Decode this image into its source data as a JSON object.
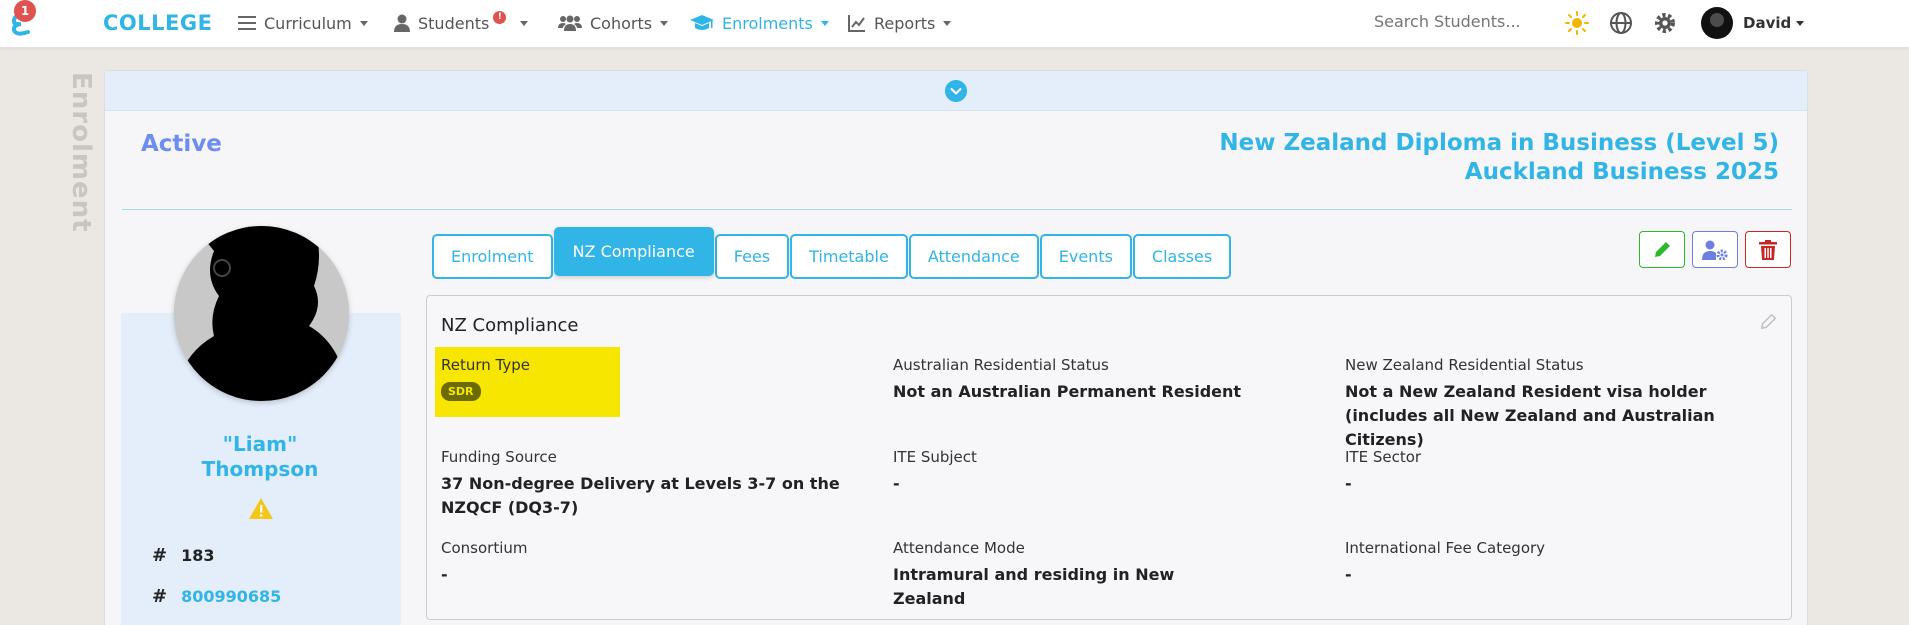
{
  "nav": {
    "notification_count": "1",
    "brand": "COLLEGE",
    "items": [
      {
        "label": "Curriculum",
        "icon": "list-icon"
      },
      {
        "label": "Students",
        "icon": "user-icon",
        "alert": "!"
      },
      {
        "label": "Cohorts",
        "icon": "users-icon"
      },
      {
        "label": "Enrolments",
        "icon": "graduation-cap-icon",
        "active": true
      },
      {
        "label": "Reports",
        "icon": "line-chart-icon"
      }
    ],
    "search_placeholder": "Search Students...",
    "user_name": "David"
  },
  "side_label": "Enrolment",
  "enrolment": {
    "status": "Active",
    "programme": "New Zealand Diploma in Business (Level 5)",
    "cohort": "Auckland Business 2025"
  },
  "student": {
    "nickname": "\"Liam\"",
    "surname": "Thompson",
    "id": "183",
    "nsn": "800990685"
  },
  "tabs": [
    "Enrolment",
    "NZ Compliance",
    "Fees",
    "Timetable",
    "Attendance",
    "Events",
    "Classes"
  ],
  "active_tab": "NZ Compliance",
  "panel": {
    "title": "NZ Compliance",
    "fields": {
      "return_type": {
        "label": "Return Type",
        "value": "SDR"
      },
      "au_res": {
        "label": "Australian Residential Status",
        "value": "Not an Australian Permanent Resident"
      },
      "nz_res": {
        "label": "New Zealand Residential Status",
        "value": "Not a New Zealand Resident visa holder (includes all New Zealand and Australian Citizens)"
      },
      "funding": {
        "label": "Funding Source",
        "value": "37 Non-degree Delivery at Levels 3-7 on the NZQCF (DQ3-7)"
      },
      "ite_subject": {
        "label": "ITE Subject",
        "value": "-"
      },
      "ite_sector": {
        "label": "ITE Sector",
        "value": "-"
      },
      "consortium": {
        "label": "Consortium",
        "value": "-"
      },
      "attendance": {
        "label": "Attendance Mode",
        "value": "Intramural and residing in New Zealand"
      },
      "intl_fee": {
        "label": "International Fee Category",
        "value": "-"
      }
    }
  },
  "colors": {
    "accent": "#31b4e6",
    "status": "#6d8df0",
    "highlight": "#f7e600",
    "edit": "#2db82d",
    "delete": "#c62828"
  }
}
